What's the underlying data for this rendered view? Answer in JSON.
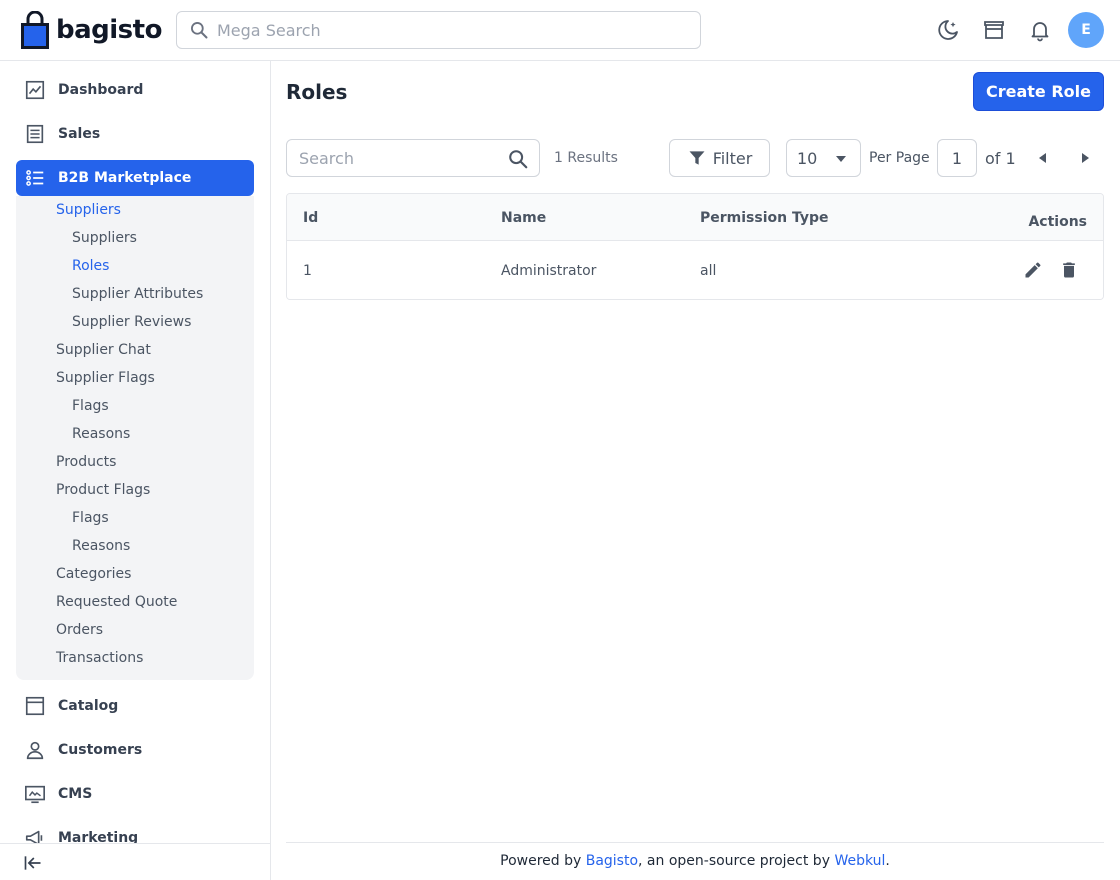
{
  "brand": {
    "name": "bagisto",
    "color": "#2563eb"
  },
  "header": {
    "search_placeholder": "Mega Search",
    "icons": [
      "dark-mode-icon",
      "storefront-icon",
      "notification-bell-icon"
    ],
    "avatar_initial": "E"
  },
  "sidebar": {
    "items": [
      {
        "label": "Dashboard",
        "icon": "dashboard-icon"
      },
      {
        "label": "Sales",
        "icon": "sales-icon"
      },
      {
        "label": "B2B Marketplace",
        "icon": "list-icon",
        "active": true
      },
      {
        "label": "Catalog",
        "icon": "catalog-icon"
      },
      {
        "label": "Customers",
        "icon": "customers-icon"
      },
      {
        "label": "CMS",
        "icon": "cms-icon"
      },
      {
        "label": "Marketing",
        "icon": "marketing-icon"
      }
    ],
    "sub_items": [
      {
        "label": "Suppliers",
        "level": 1,
        "highlighted": true
      },
      {
        "label": "Suppliers",
        "level": 2
      },
      {
        "label": "Roles",
        "level": 2,
        "highlighted": true
      },
      {
        "label": "Supplier Attributes",
        "level": 2
      },
      {
        "label": "Supplier Reviews",
        "level": 2
      },
      {
        "label": "Supplier Chat",
        "level": 1
      },
      {
        "label": "Supplier Flags",
        "level": 1
      },
      {
        "label": "Flags",
        "level": 2
      },
      {
        "label": "Reasons",
        "level": 2
      },
      {
        "label": "Products",
        "level": 1
      },
      {
        "label": "Product Flags",
        "level": 1
      },
      {
        "label": "Flags",
        "level": 2
      },
      {
        "label": "Reasons",
        "level": 2
      },
      {
        "label": "Categories",
        "level": 1
      },
      {
        "label": "Requested Quote",
        "level": 1
      },
      {
        "label": "Orders",
        "level": 1
      },
      {
        "label": "Transactions",
        "level": 1
      }
    ],
    "collapse_icon": "collapse-sidebar-icon"
  },
  "main": {
    "title": "Roles",
    "create_button": "Create Role",
    "toolbar": {
      "search_placeholder": "Search",
      "results": "1 Results",
      "filter_label": "Filter",
      "per_page_value": "10",
      "per_page_label": "Per Page",
      "current_page": "1",
      "of_total": "of 1"
    },
    "table": {
      "columns": [
        "Id",
        "Name",
        "Permission Type",
        "Actions"
      ],
      "rows": [
        {
          "id": "1",
          "name": "Administrator",
          "permission_type": "all"
        }
      ]
    }
  },
  "footer": {
    "prefix": "Powered by ",
    "link1": "Bagisto",
    "middle": ", an open-source project by ",
    "link2": "Webkul",
    "suffix": "."
  }
}
